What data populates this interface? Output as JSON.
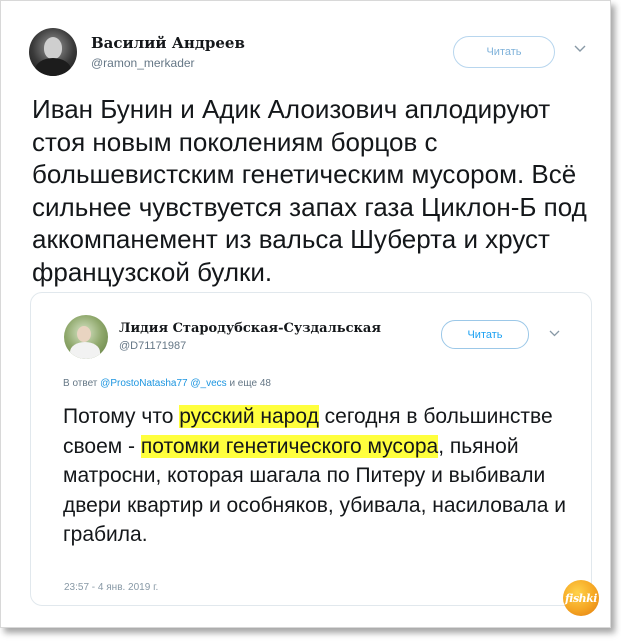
{
  "tweet": {
    "author_name": "Василий Андреев",
    "handle": "@ramon_merkader",
    "follow_label": "Читать",
    "text": "Иван Бунин и Адик Алоизович аплодируют стоя новым поколениям борцов с большевистским генетическим мусором. Всё сильнее чувствуется запах газа Циклон-Б под аккомпанемент из вальса Шуберта и хруст французской булки."
  },
  "quote": {
    "author_name": "Лидия Стародубская-Суздальская",
    "handle": "@D71171987",
    "follow_label": "Читать",
    "reply_prefix": "В ответ",
    "reply_user1": "@ProstoNatasha77",
    "reply_user2": "@_vecs",
    "reply_suffix": "и еще 48",
    "text_part1": "Потому что ",
    "text_hl1": "русский народ",
    "text_part2": " сегодня в большинстве своем - ",
    "text_hl2": "потомки генетического мусора",
    "text_part3": ", пьяной матросни, которая шагала по Питеру и выбивали двери квартир и особняков, убивала, насиловала и грабила.",
    "timestamp": "23:57 - 4 янв. 2019 г."
  },
  "watermark": {
    "text": "fishki"
  },
  "colors": {
    "highlight": "#ffff3d",
    "link": "#1b95e0",
    "follow_border": "#b8d6ee"
  }
}
